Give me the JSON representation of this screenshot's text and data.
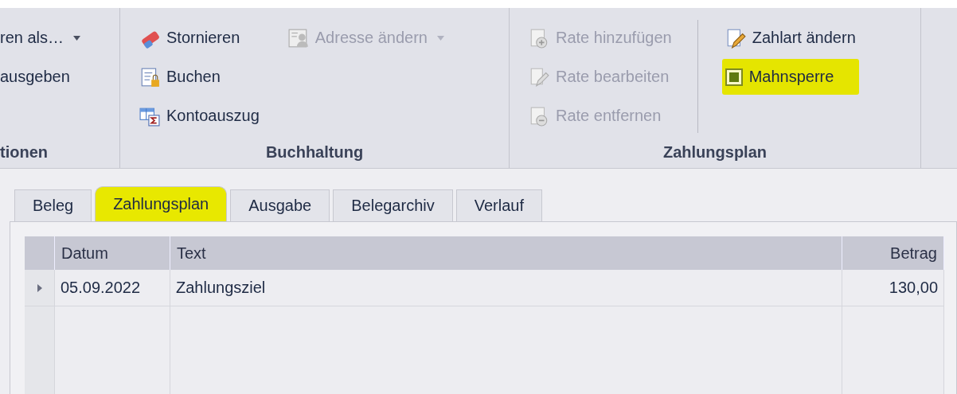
{
  "ribbon": {
    "groups": [
      {
        "label": "tionen",
        "columns": [
          [
            {
              "kind": "button",
              "label": "ren als…",
              "dropdown": true,
              "disabled": false,
              "highlighted": false
            },
            {
              "kind": "button",
              "label": "ausgeben",
              "dropdown": false,
              "disabled": false,
              "highlighted": false
            }
          ]
        ]
      },
      {
        "label": "Buchhaltung",
        "columns": [
          [
            {
              "kind": "button",
              "label": "Stornieren",
              "dropdown": false,
              "disabled": false,
              "highlighted": false
            },
            {
              "kind": "button",
              "label": "Buchen",
              "dropdown": false,
              "disabled": false,
              "highlighted": false
            },
            {
              "kind": "button",
              "label": "Kontoauszug",
              "dropdown": false,
              "disabled": false,
              "highlighted": false
            }
          ],
          [
            {
              "kind": "button",
              "label": "Adresse ändern",
              "dropdown": true,
              "disabled": true,
              "highlighted": false
            }
          ]
        ]
      },
      {
        "label": "Zahlungsplan",
        "columns": [
          [
            {
              "kind": "button",
              "label": "Rate hinzufügen",
              "dropdown": false,
              "disabled": true,
              "highlighted": false
            },
            {
              "kind": "button",
              "label": "Rate bearbeiten",
              "dropdown": false,
              "disabled": true,
              "highlighted": false
            },
            {
              "kind": "button",
              "label": "Rate entfernen",
              "dropdown": false,
              "disabled": true,
              "highlighted": false
            }
          ],
          [
            {
              "kind": "button",
              "label": "Zahlart ändern",
              "dropdown": false,
              "disabled": false,
              "highlighted": false
            },
            {
              "kind": "checkbox",
              "label": "Mahnsperre",
              "checked": true,
              "dropdown": false,
              "disabled": false,
              "highlighted": true
            }
          ]
        ]
      }
    ]
  },
  "tabs": [
    {
      "label": "Beleg",
      "selected": false,
      "highlighted": false
    },
    {
      "label": "Zahlungsplan",
      "selected": true,
      "highlighted": true
    },
    {
      "label": "Ausgabe",
      "selected": false,
      "highlighted": false
    },
    {
      "label": "Belegarchiv",
      "selected": false,
      "highlighted": false
    },
    {
      "label": "Verlauf",
      "selected": false,
      "highlighted": false
    }
  ],
  "grid": {
    "columns": [
      {
        "label": "Datum"
      },
      {
        "label": "Text"
      },
      {
        "label": "Betrag"
      }
    ],
    "rows": [
      {
        "current": true,
        "cells": [
          "05.09.2022",
          "Zahlungsziel",
          "130,00"
        ]
      }
    ]
  }
}
